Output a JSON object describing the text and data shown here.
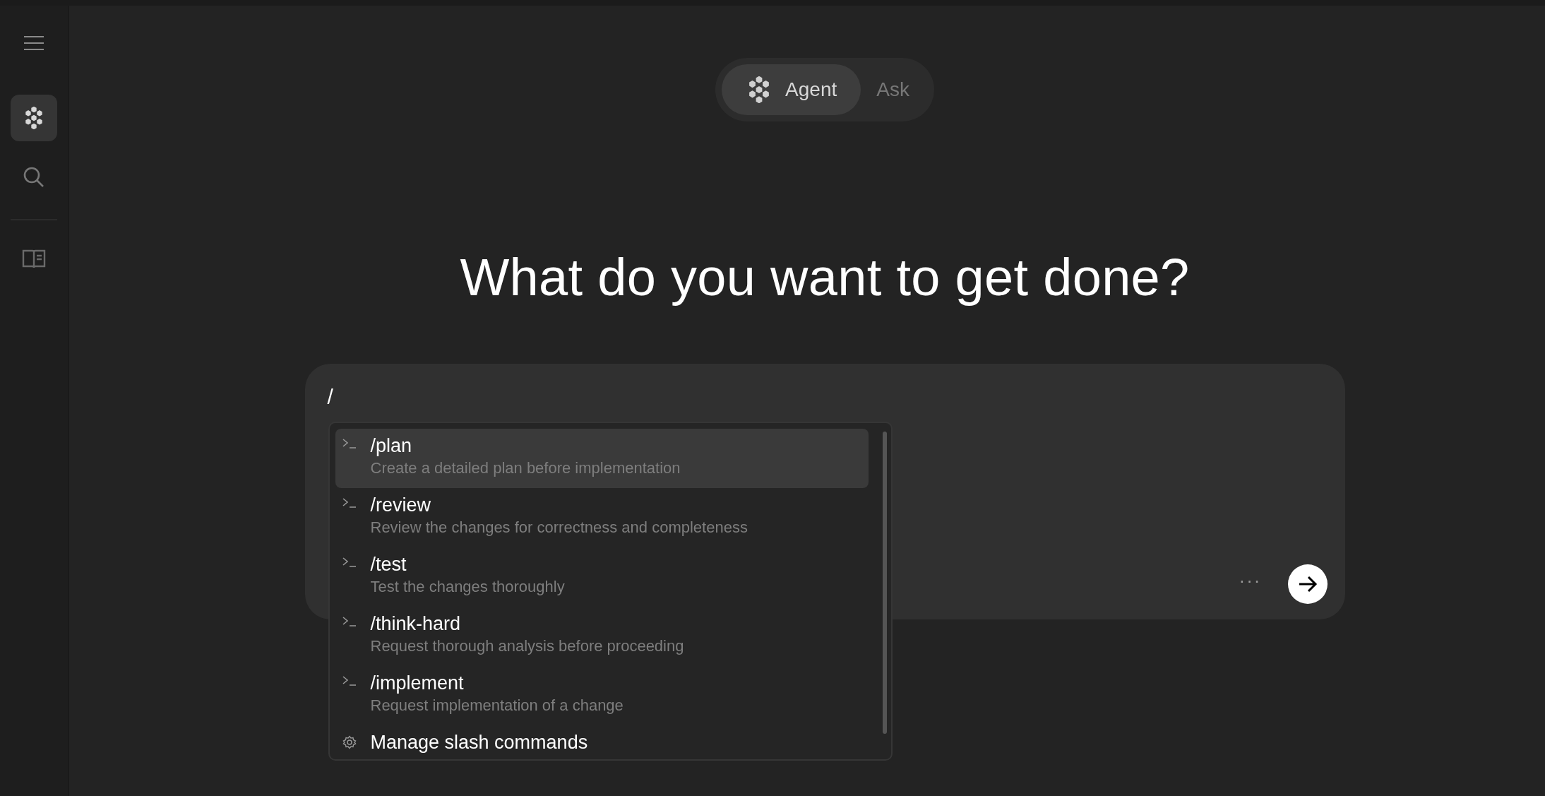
{
  "sidebar": {
    "items": [
      {
        "kind": "menu",
        "selected": false
      },
      {
        "kind": "agent",
        "selected": true
      },
      {
        "kind": "search",
        "selected": false
      },
      {
        "kind": "book",
        "selected": false
      }
    ]
  },
  "mode_toggle": [
    {
      "label": "Agent",
      "kind": "icon-tab",
      "selected": true
    },
    {
      "label": "Ask",
      "kind": "text-tab",
      "selected": false
    }
  ],
  "heading": "What do you want to get done?",
  "composer": {
    "value": "/"
  },
  "slash_menu": {
    "items": [
      {
        "kind": "command",
        "name": "/plan",
        "description": "Create a detailed plan before implementation",
        "selected": true
      },
      {
        "kind": "command",
        "name": "/review",
        "description": "Review the changes for correctness and completeness",
        "selected": false
      },
      {
        "kind": "command",
        "name": "/test",
        "description": "Test the changes thoroughly",
        "selected": false
      },
      {
        "kind": "command",
        "name": "/think-hard",
        "description": "Request thorough analysis before proceeding",
        "selected": false
      },
      {
        "kind": "command",
        "name": "/implement",
        "description": "Request implementation of a change",
        "selected": false
      },
      {
        "kind": "settings",
        "name": "Manage slash commands",
        "selected": false
      }
    ]
  },
  "more_button": "···"
}
